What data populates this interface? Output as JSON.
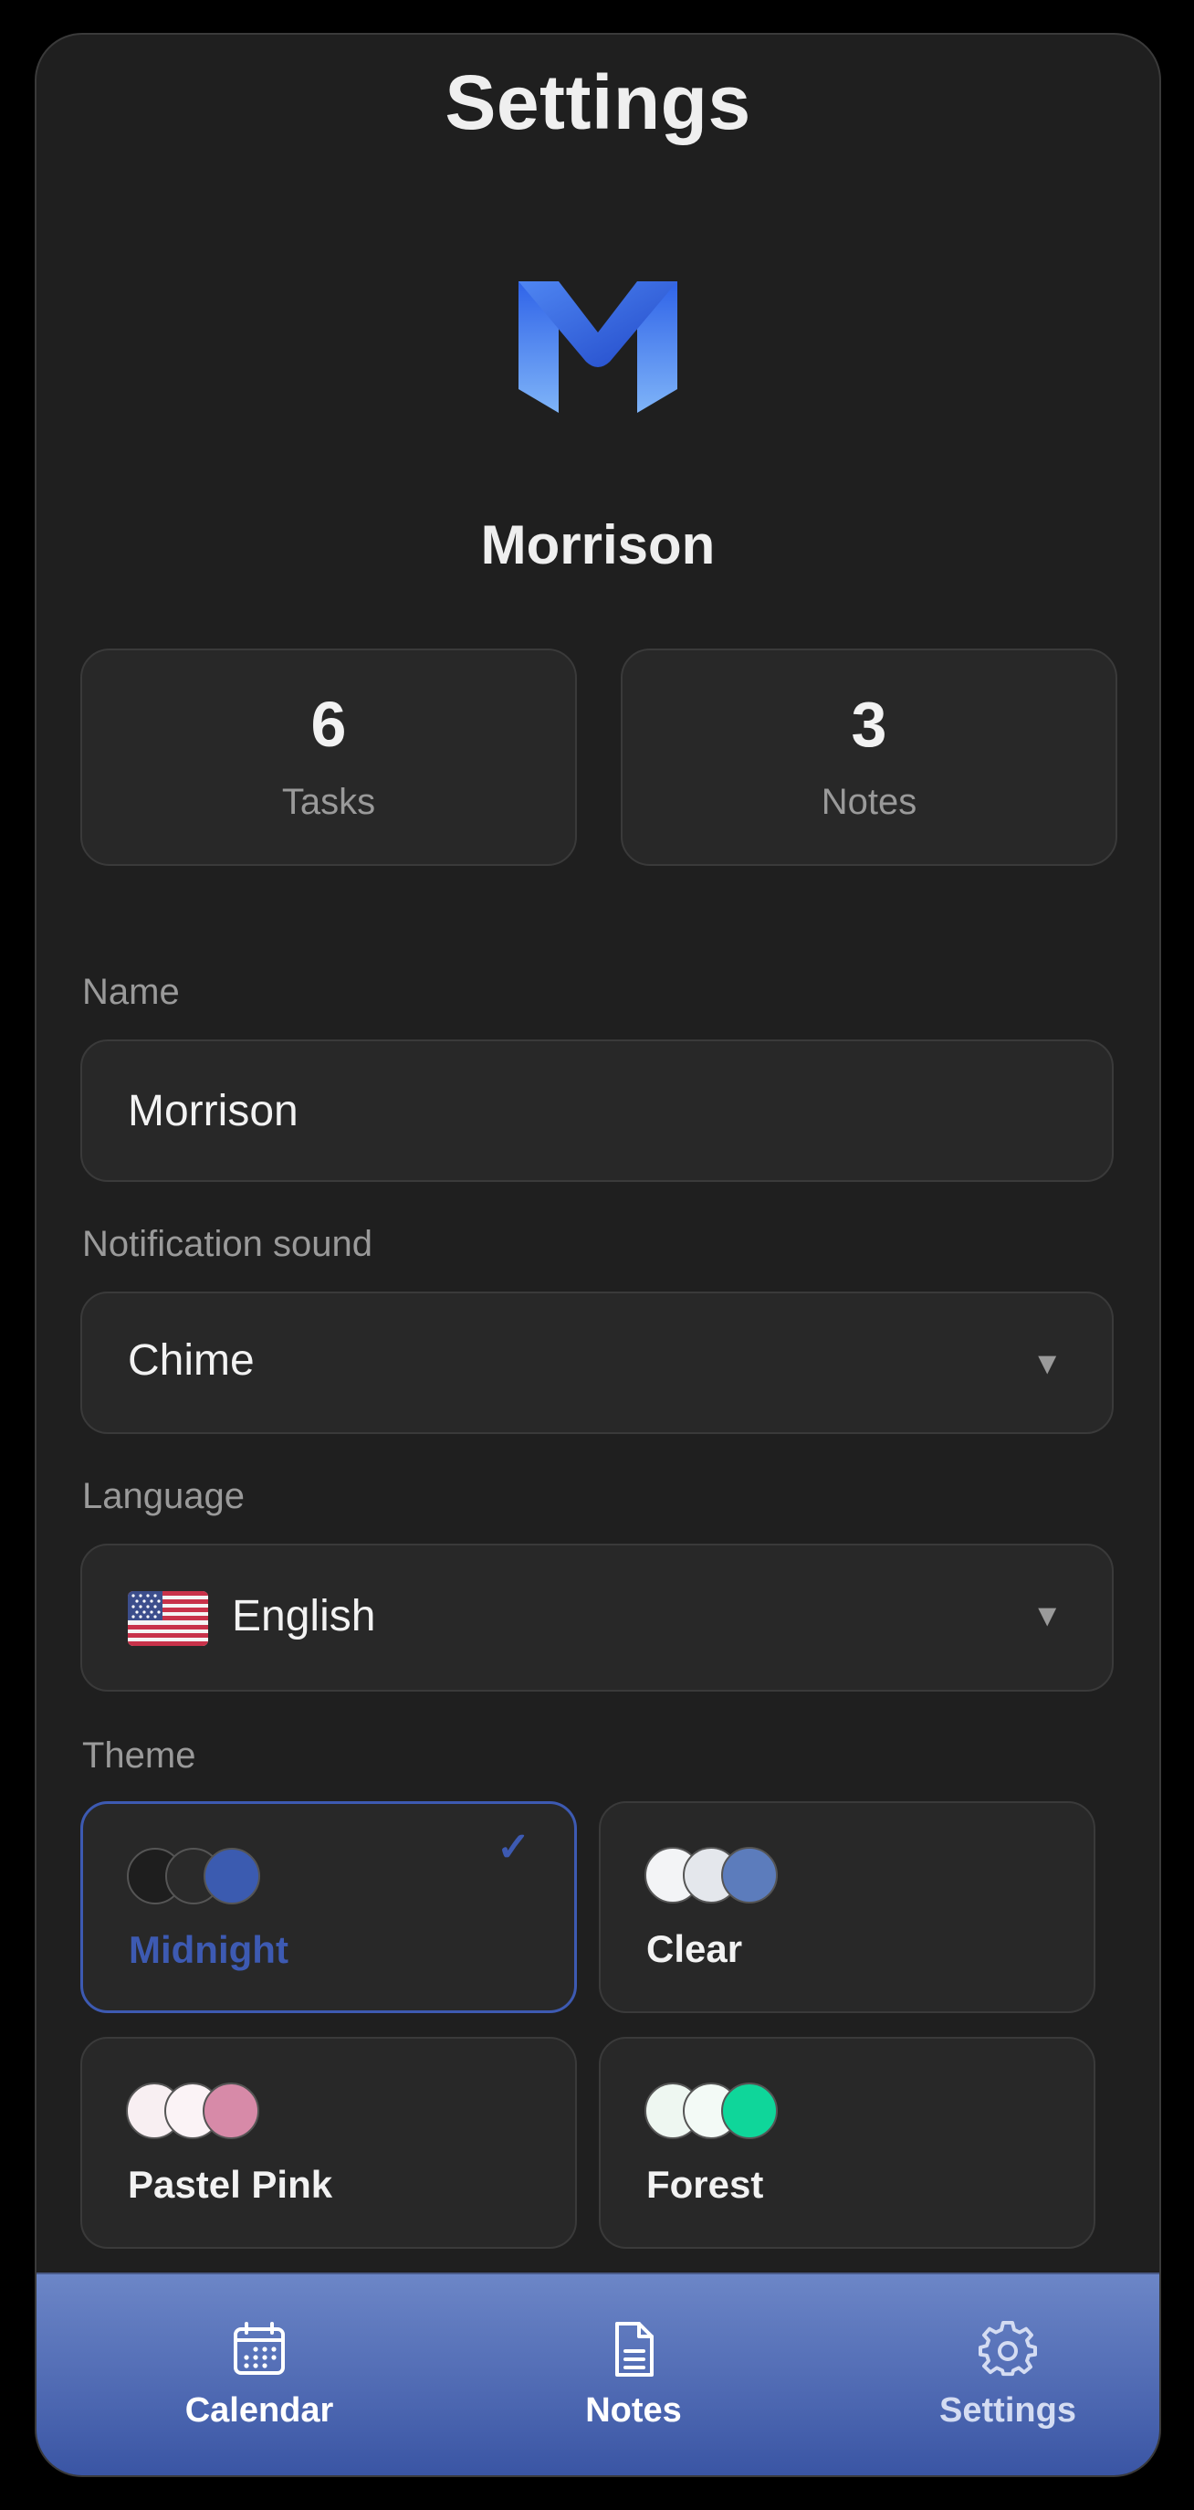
{
  "header": {
    "title": "Settings"
  },
  "profile": {
    "name": "Morrison",
    "logo_icon": "m-logo-icon"
  },
  "stats": [
    {
      "value": "6",
      "label": "Tasks"
    },
    {
      "value": "3",
      "label": "Notes"
    }
  ],
  "form": {
    "name_label": "Name",
    "name_value": "Morrison",
    "sound_label": "Notification sound",
    "sound_value": "Chime",
    "language_label": "Language",
    "language_value": "English",
    "language_flag_icon": "us-flag-icon"
  },
  "theme": {
    "label": "Theme",
    "accent_color": "#3d5ab2",
    "options": [
      {
        "name": "Midnight",
        "selected": true,
        "colors": [
          "#1e1e1e",
          "#2a2a2a",
          "#3b5bb0"
        ]
      },
      {
        "name": "Clear",
        "selected": false,
        "colors": [
          "#f3f4f6",
          "#e4e7ec",
          "#5c7cbc"
        ]
      },
      {
        "name": "Pastel Pink",
        "selected": false,
        "colors": [
          "#f8eff2",
          "#fbf3f6",
          "#d78aa8"
        ]
      },
      {
        "name": "Forest",
        "selected": false,
        "colors": [
          "#eef7f1",
          "#f3faf6",
          "#0fd69a"
        ]
      }
    ]
  },
  "tabbar": {
    "items": [
      {
        "label": "Calendar",
        "icon": "calendar-icon"
      },
      {
        "label": "Notes",
        "icon": "document-icon"
      },
      {
        "label": "Settings",
        "icon": "gear-icon",
        "active": true
      }
    ]
  }
}
